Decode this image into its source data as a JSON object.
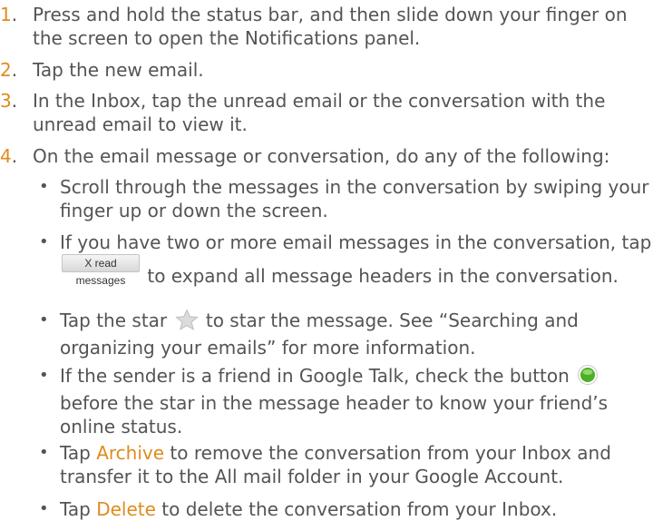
{
  "steps": [
    {
      "number": "1",
      "text": "Press and hold the status bar, and then slide down your finger on the screen to open the Notifications panel."
    },
    {
      "number": "2",
      "text": "Tap the new email."
    },
    {
      "number": "3",
      "text": "In the Inbox, tap the unread email or the conversation with the unread email to view it."
    },
    {
      "number": "4",
      "text": "On the email message or conversation, do any of the following:"
    }
  ],
  "bullets": {
    "scroll": "Scroll through the messages in the conversation by swiping your finger up or down the screen.",
    "expand_before": "If you have two or more email messages in the conversation, tap",
    "expand_button": "X read messages",
    "expand_after": "to expand all message headers in the conversation.",
    "star_before": "Tap the star",
    "star_after": "to star the message. See “Searching and organizing your emails” for more information.",
    "status_before": "If the sender is a friend in Google Talk, check the button",
    "status_after": "before the star in the message header to know your friend’s online status.",
    "archive_tap": "Tap",
    "archive_keyword": "Archive",
    "archive_after": "to remove the conversation from your Inbox and transfer it to the All mail folder in your Google Account.",
    "delete_tap": "Tap",
    "delete_keyword": "Delete",
    "delete_after": "to delete the conversation from your Inbox."
  },
  "bullet_symbol": "•",
  "colors": {
    "accent": "#e08b1e",
    "text": "#545454",
    "status_dot": "#4caf27",
    "star": "#d4d4d4"
  },
  "icons": {
    "star": "star-icon",
    "online": "online-status-icon"
  }
}
